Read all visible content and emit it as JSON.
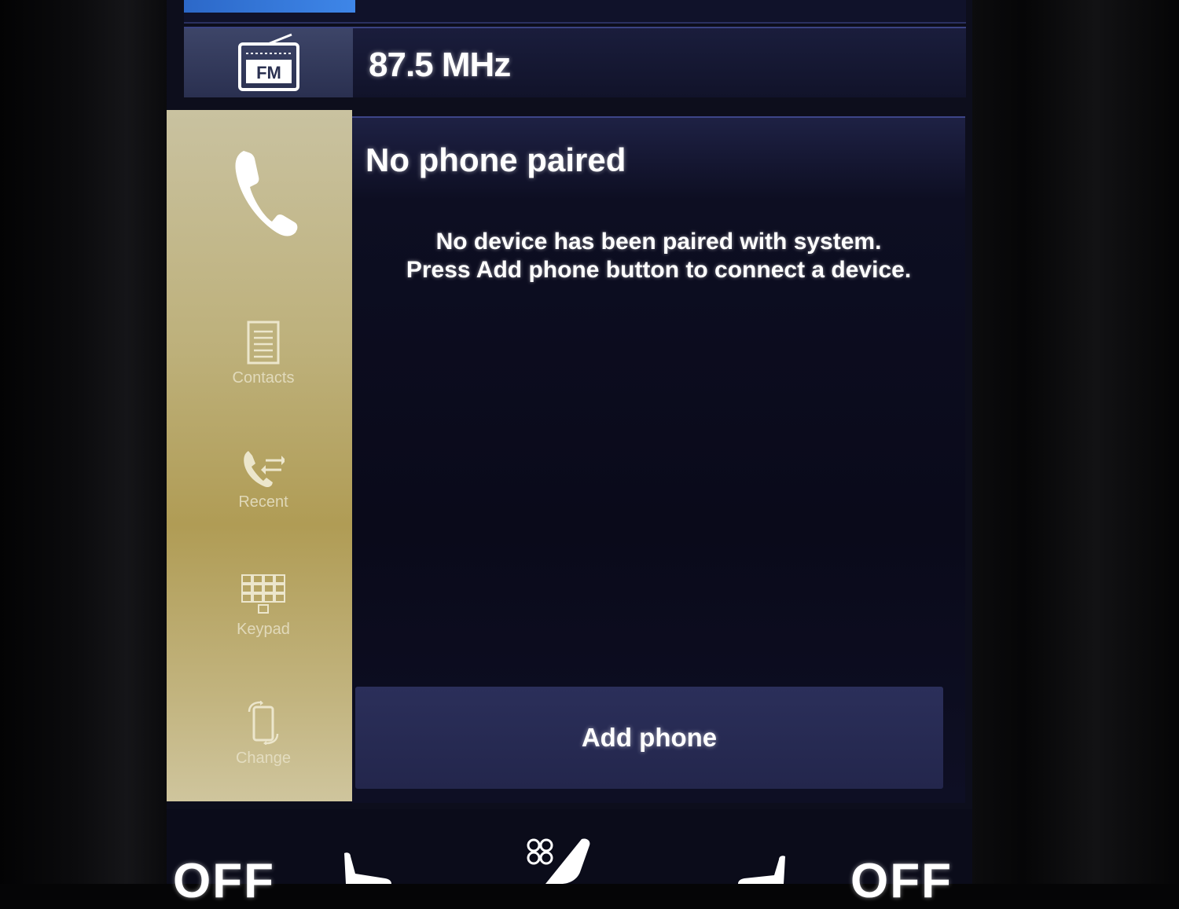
{
  "radio": {
    "icon": "fm-radio-icon",
    "label": "FM",
    "frequency": "87.5 MHz"
  },
  "phone": {
    "icon": "phone-handset-icon",
    "title": "No phone paired",
    "message_line1": "No device has been paired with system.",
    "message_line2": "Press Add phone button to connect a device.",
    "add_button_label": "Add phone",
    "nav": [
      {
        "label": "Contacts",
        "icon": "contacts-icon"
      },
      {
        "label": "Recent",
        "icon": "recent-calls-icon"
      },
      {
        "label": "Keypad",
        "icon": "keypad-icon"
      },
      {
        "label": "Change",
        "icon": "change-phone-icon"
      }
    ]
  },
  "climate": {
    "left_status": "OFF",
    "right_status": "OFF",
    "icons": [
      "seat-heat-left-icon",
      "fan-icon",
      "seat-heat-center-icon",
      "seat-heat-right-icon"
    ]
  },
  "colors": {
    "side_panel_gold": "#bdb07a",
    "screen_bg": "#0a0a1a",
    "button_bg": "#2b2f5a",
    "accent_blue": "#3e86e8"
  }
}
